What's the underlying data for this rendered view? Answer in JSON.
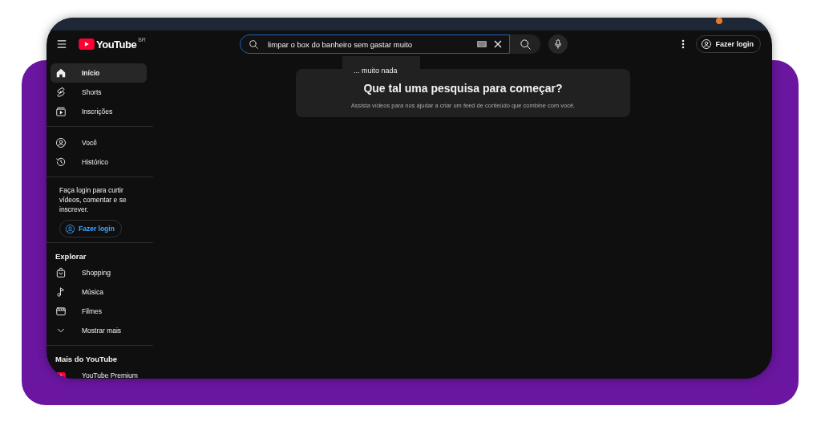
{
  "header": {
    "logo_text": "YouTube",
    "region": "BR",
    "search": {
      "value": "limpar o box do banheiro sem gastar muito"
    },
    "login_button": "Fazer login"
  },
  "suggestions": [
    "... muito nada"
  ],
  "sidebar": [
    {
      "kind": "nav",
      "items": [
        {
          "label": "Início",
          "selected": true
        },
        {
          "label": "Shorts",
          "selected": false
        },
        {
          "label": "Inscrições",
          "selected": false
        }
      ]
    },
    {
      "kind": "nav",
      "items": [
        {
          "label": "Você",
          "selected": false
        },
        {
          "label": "Histórico",
          "selected": false
        }
      ]
    },
    {
      "kind": "prompt",
      "text": "Faça login para curtir vídeos, comentar e se inscrever.",
      "button": "Fazer login"
    },
    {
      "kind": "nav",
      "heading": "Explorar",
      "items": [
        {
          "label": "Shopping",
          "selected": false
        },
        {
          "label": "Música",
          "selected": false
        },
        {
          "label": "Filmes",
          "selected": false
        },
        {
          "label": "Mostrar mais",
          "selected": false
        }
      ]
    },
    {
      "kind": "nav",
      "heading": "Mais do YouTube",
      "items": [
        {
          "label": "YouTube Premium",
          "selected": false
        }
      ]
    }
  ],
  "prompt_card": {
    "title": "Que tal uma pesquisa para começar?",
    "text": "Assista vídeos para nos ajudar a criar um feed de conteúdo que combine com você."
  }
}
